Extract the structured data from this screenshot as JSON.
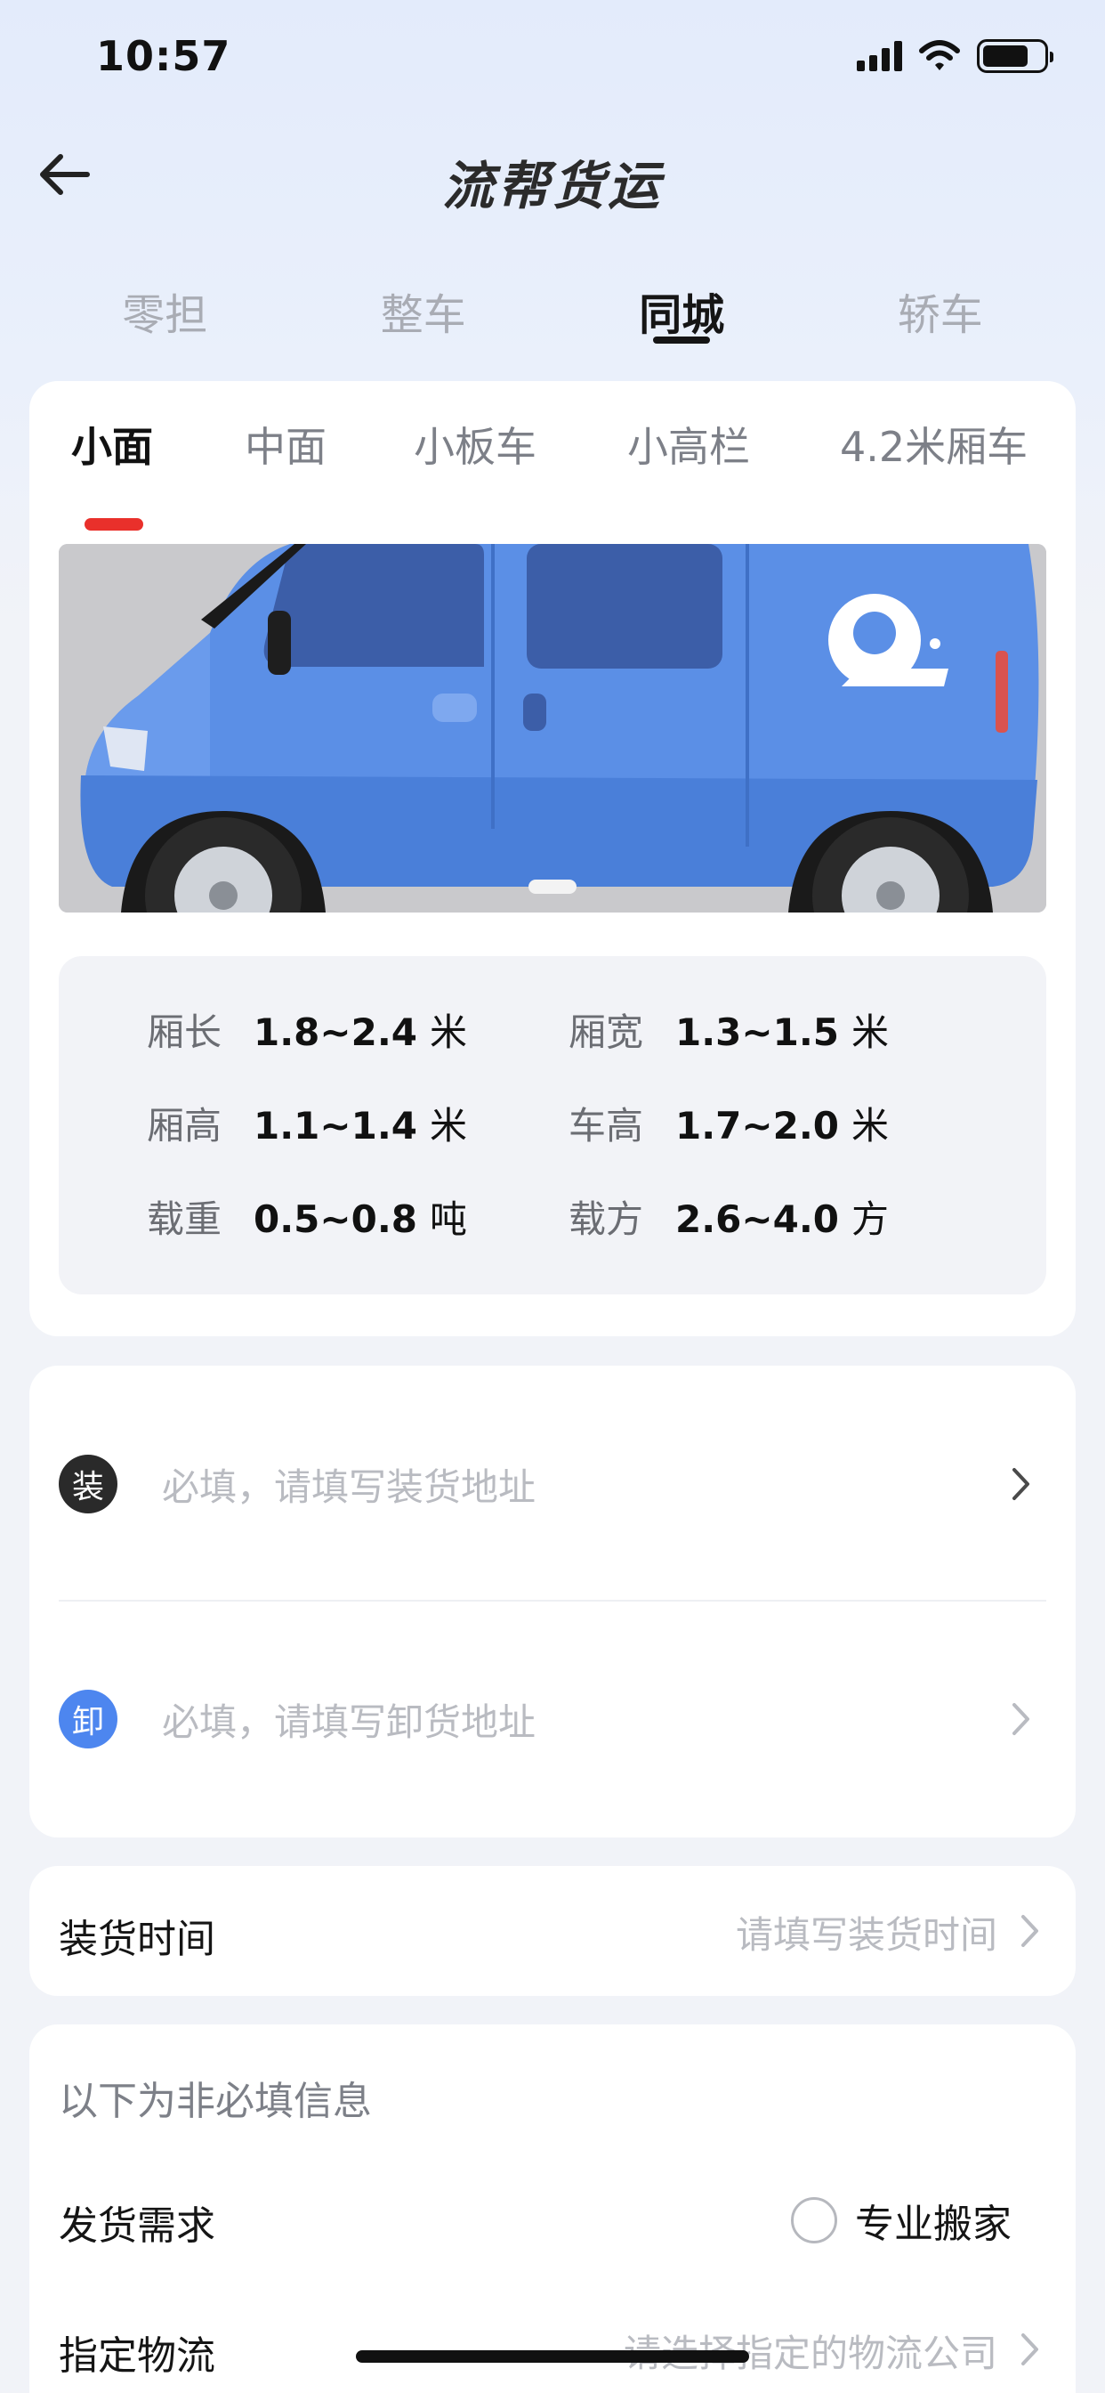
{
  "status_bar": {
    "time": "10:57"
  },
  "nav": {
    "title": "流帮货运"
  },
  "top_tabs": [
    "零担",
    "整车",
    "同城",
    "轿车"
  ],
  "top_tab_active": "同城",
  "vehicle_tabs": [
    "小面",
    "中面",
    "小板车",
    "小高栏",
    "4.2米厢车"
  ],
  "vehicle_tab_active": "小面",
  "specs": [
    {
      "label": "厢长",
      "value": "1.8~2.4",
      "unit": "米"
    },
    {
      "label": "厢宽",
      "value": "1.3~1.5",
      "unit": "米"
    },
    {
      "label": "厢高",
      "value": "1.1~1.4",
      "unit": "米"
    },
    {
      "label": "车高",
      "value": "1.7~2.0",
      "unit": "米"
    },
    {
      "label": "载重",
      "value": "0.5~0.8",
      "unit": "吨"
    },
    {
      "label": "载方",
      "value": "2.6~4.0",
      "unit": "方"
    }
  ],
  "address": {
    "load_badge": "装",
    "load_placeholder": "必填，请填写装货地址",
    "unload_badge": "卸",
    "unload_placeholder": "必填，请填写卸货地址"
  },
  "load_time": {
    "label": "装货时间",
    "placeholder": "请填写装货时间"
  },
  "optional": {
    "title": "以下为非必填信息",
    "demand_label": "发货需求",
    "demand_option": "专业搬家",
    "logistics_label": "指定物流",
    "logistics_placeholder": "请选择指定的物流公司"
  },
  "colors": {
    "accent_red": "#e9302b",
    "unload_blue": "#4d86ef",
    "load_dark": "#2a2a2a",
    "van_blue": "#5b8fe6"
  },
  "icons": {
    "back": "arrow-left-icon",
    "chevron": "chevron-right-icon",
    "signal": "signal-icon",
    "wifi": "wifi-icon",
    "battery": "battery-icon"
  }
}
